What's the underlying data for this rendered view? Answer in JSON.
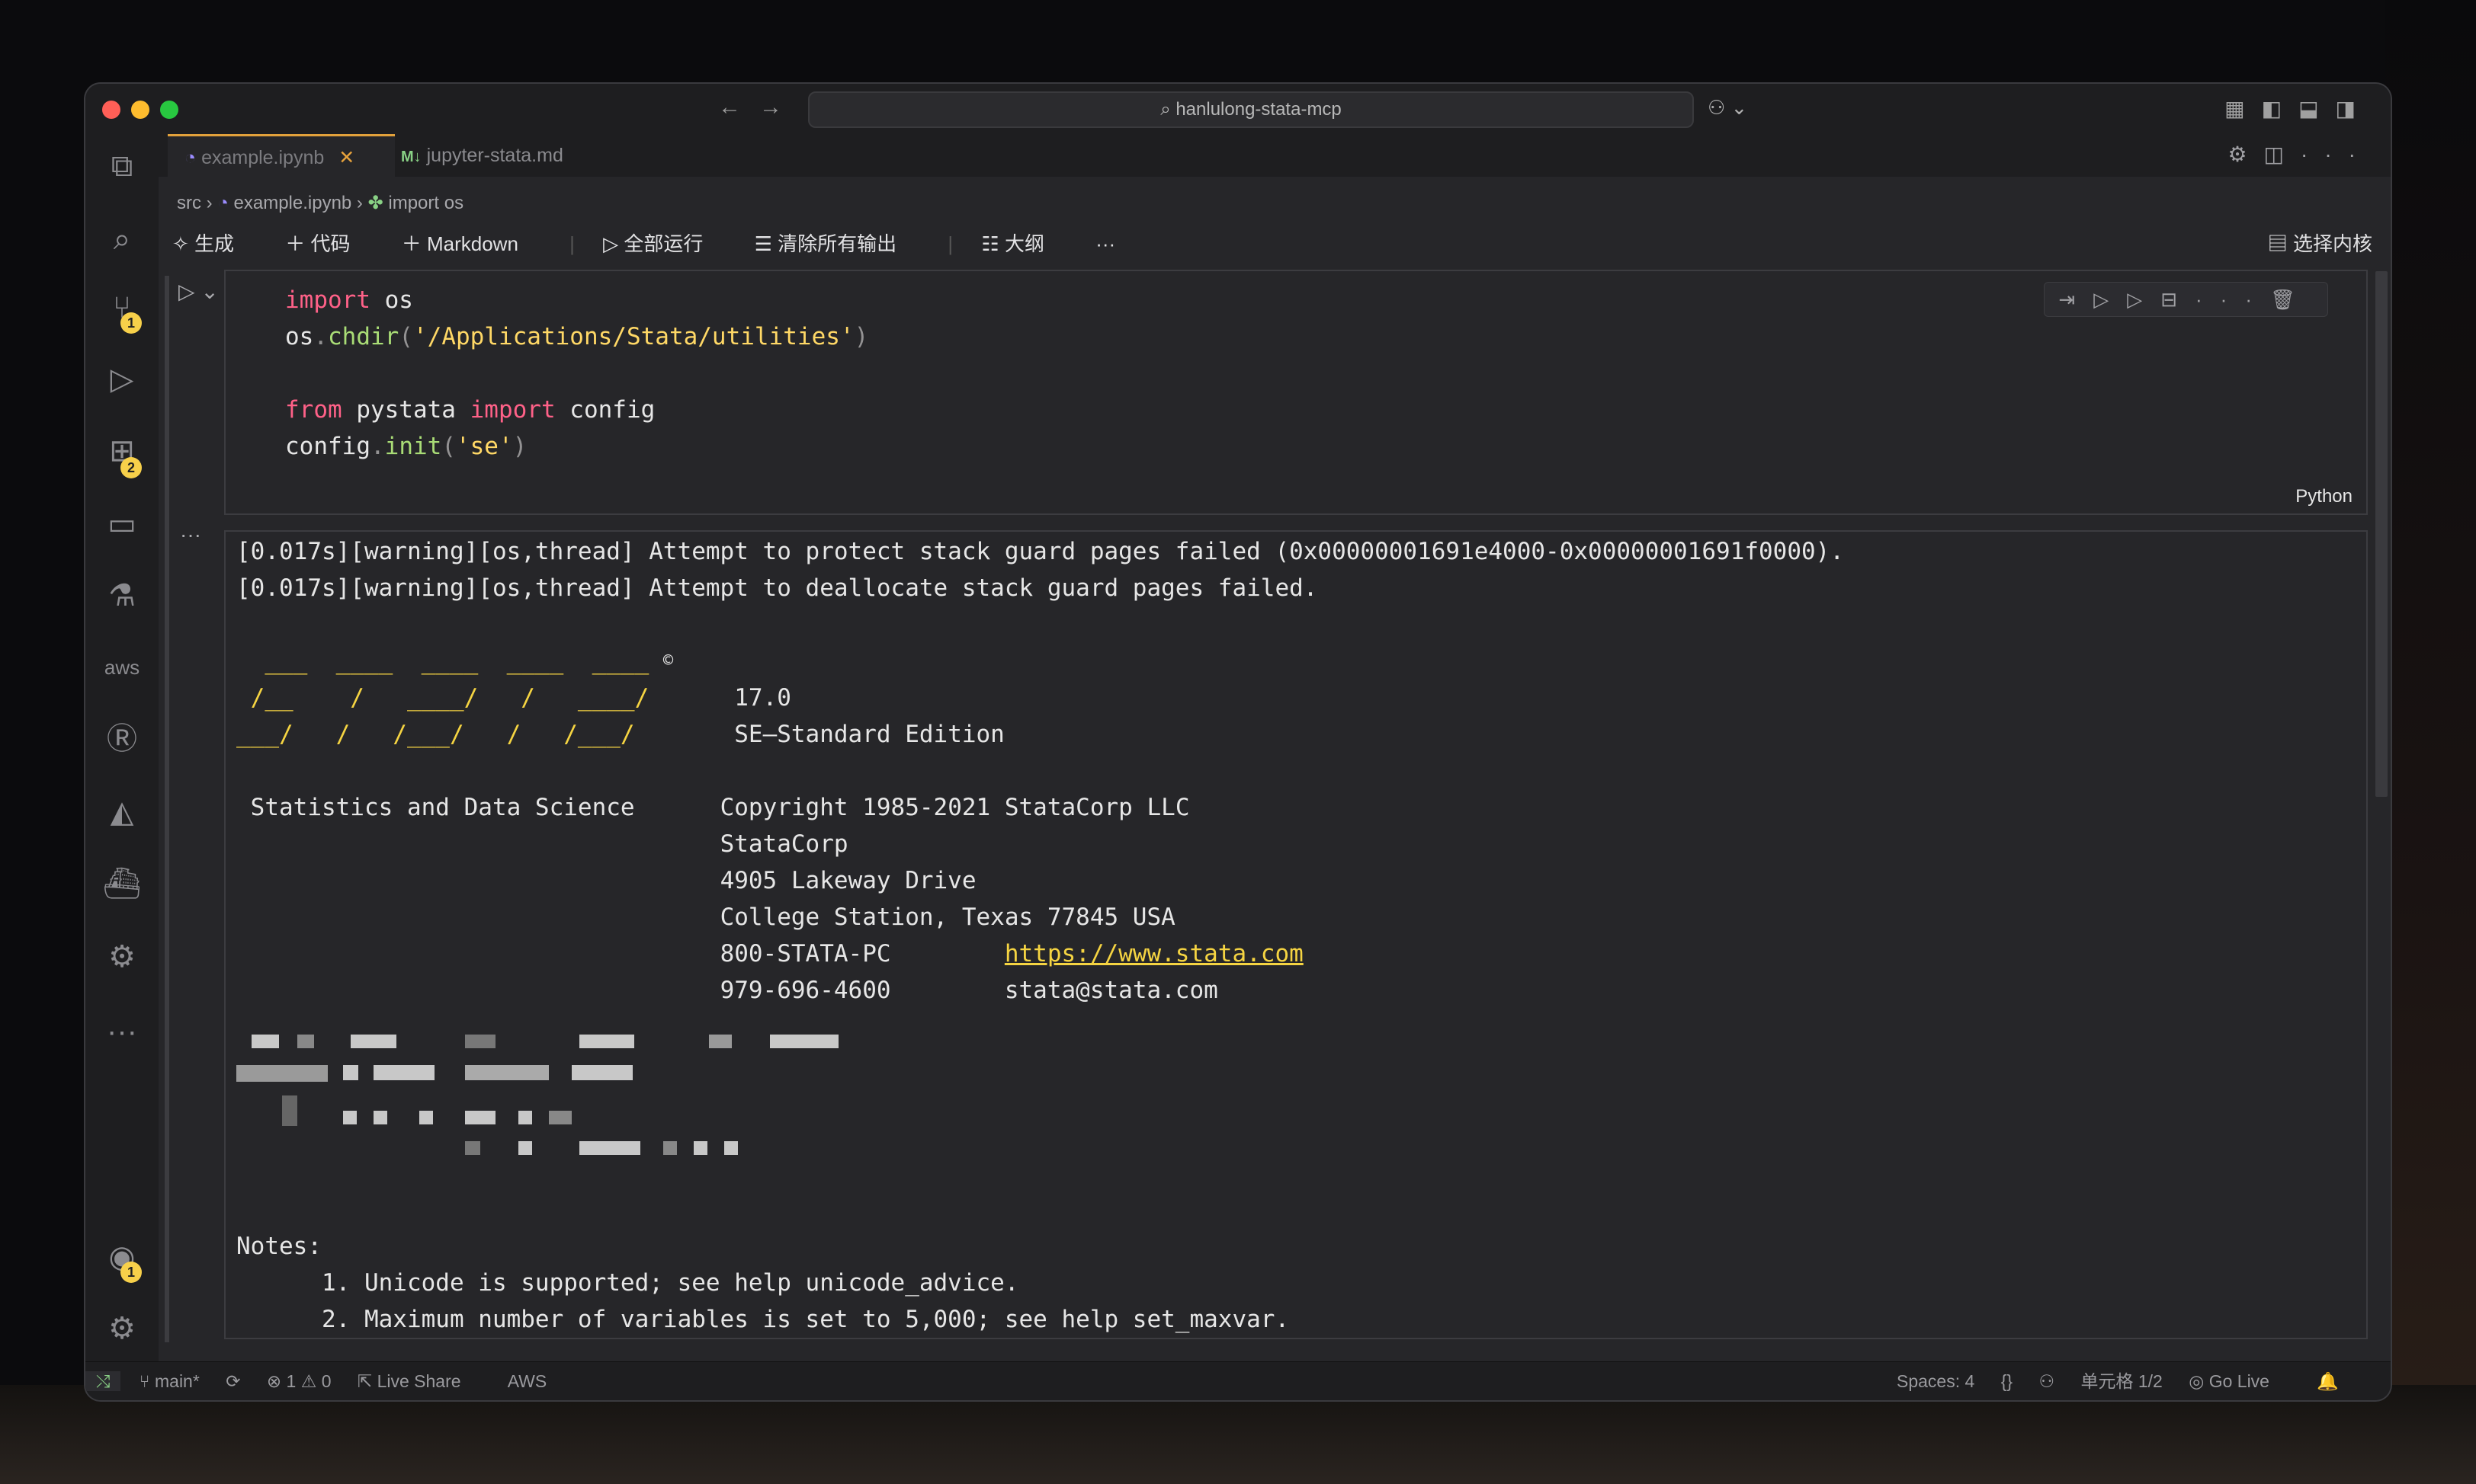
{
  "search": {
    "text": "hanlulong-stata-mcp"
  },
  "tabs": [
    {
      "label": "example.ipynb",
      "close": "✕"
    },
    {
      "label": "jupyter-stata.md"
    }
  ],
  "breadcrumb": {
    "a": "src",
    "b": "example.ipynb",
    "c": "import os"
  },
  "toolbar": {
    "generate": "生成",
    "code": "代码",
    "markdown": "Markdown",
    "run_all": "全部运行",
    "clear_all": "清除所有输出",
    "outline": "大纲",
    "more": "···",
    "kernel": "选择内核"
  },
  "code_cell": {
    "language": "Python",
    "l1_kw": "import",
    "l1_rest": " os",
    "l2_a": "os",
    "l2_dot": ".",
    "l2_fn": "chdir",
    "l2_p1": "(",
    "l2_str": "'/Applications/Stata/utilities'",
    "l2_p2": ")",
    "l4_kw1": "from",
    "l4_mid": " pystata ",
    "l4_kw2": "import",
    "l4_rest": " config",
    "l5_a": "config",
    "l5_dot": ".",
    "l5_fn": "init",
    "l5_p1": "(",
    "l5_str": "'se'",
    "l5_p2": ")"
  },
  "output": {
    "warn1": "[0.017s][warning][os,thread] Attempt to protect stack guard pages failed (0x00000001691e4000-0x00000001691f0000).",
    "warn2": "[0.017s][warning][os,thread] Attempt to deallocate stack guard pages failed.",
    "logo1": "  ___  ____  ____  ____  ____ ",
    "logo1b": "©",
    "logo2a": " /__    /   ____/   /   ____/ ",
    "logo2b": "     17.0",
    "logo3a": "___/   /   /___/   /   /___/  ",
    "logo3b": "     SE—Standard Edition",
    "stats": " Statistics and Data Science",
    "copyright": "Copyright 1985-2021 StataCorp LLC",
    "company": "StataCorp",
    "address": "4905 Lakeway Drive",
    "city": "College Station, Texas 77845 USA",
    "phone1": "800-STATA-PC",
    "url": "https://www.stata.com",
    "phone2": "979-696-4600",
    "email": "stata@stata.com",
    "notes": "Notes:",
    "note1": "      1. Unicode is supported; see help unicode_advice.",
    "note2": "      2. Maximum number of variables is set to 5,000; see help set_maxvar."
  },
  "status": {
    "branch": "main*",
    "problems": "⊗ 1 ⚠ 0",
    "live_share": "Live Share",
    "aws": "AWS",
    "spaces": "Spaces: 4",
    "cell": "单元格 1/2",
    "go_live": "Go Live"
  },
  "badges": {
    "source_control": "1",
    "extensions": "2",
    "accounts": "1"
  }
}
